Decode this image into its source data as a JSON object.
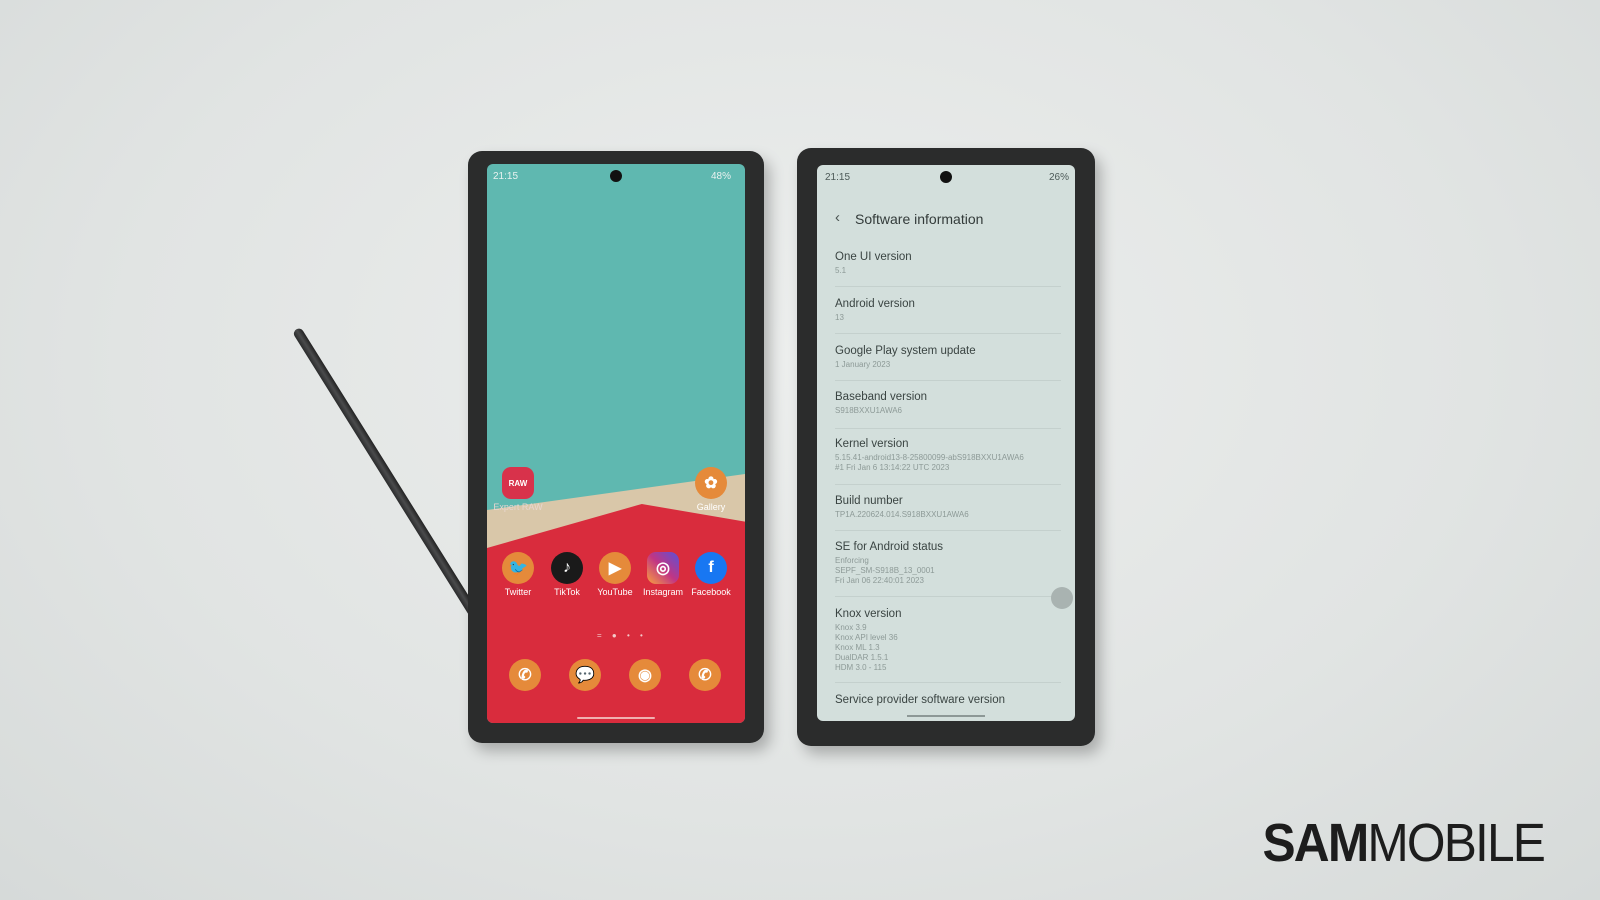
{
  "left_phone": {
    "status": {
      "time": "21:15",
      "battery": "48%"
    },
    "top_apps": [
      {
        "label": "Expert RAW",
        "badge": "RAW",
        "color": "#d8324b"
      },
      {
        "label": "Gallery",
        "color": "#e58a3a"
      }
    ],
    "apps": [
      {
        "label": "Twitter",
        "icon": "twitter-icon",
        "color": "#e58a3a"
      },
      {
        "label": "TikTok",
        "icon": "tiktok-icon",
        "color": "#1a1a1a"
      },
      {
        "label": "YouTube",
        "icon": "youtube-icon",
        "color": "#e58a3a"
      },
      {
        "label": "Instagram",
        "icon": "instagram-icon",
        "color": "#c13584"
      },
      {
        "label": "Facebook",
        "icon": "facebook-icon",
        "color": "#1877f2"
      }
    ],
    "dock": [
      {
        "icon": "phone-icon"
      },
      {
        "icon": "messages-icon"
      },
      {
        "icon": "camera-icon"
      },
      {
        "icon": "whatsapp-icon"
      }
    ]
  },
  "right_phone": {
    "status": {
      "time": "21:15",
      "battery": "26%"
    },
    "title": "Software information",
    "items": [
      {
        "title": "One UI version",
        "value": "5.1"
      },
      {
        "title": "Android version",
        "value": "13"
      },
      {
        "title": "Google Play system update",
        "value": "1 January 2023"
      },
      {
        "title": "Baseband version",
        "value": "S918BXXU1AWA6"
      },
      {
        "title": "Kernel version",
        "value": "5.15.41-android13-8-25800099-abS918BXXU1AWA6\n#1 Fri Jan 6 13:14:22 UTC 2023"
      },
      {
        "title": "Build number",
        "value": "TP1A.220624.014.S918BXXU1AWA6"
      },
      {
        "title": "SE for Android status",
        "value": "Enforcing\nSEPF_SM-S918B_13_0001\nFri Jan 06 22:40:01 2023"
      },
      {
        "title": "Knox version",
        "value": "Knox 3.9\nKnox API level 36\nKnox ML 1.3\nDualDAR 1.5.1\nHDM 3.0 - 115"
      },
      {
        "title": "Service provider software version",
        "value": ""
      }
    ]
  },
  "watermark": "SAMMOBILE"
}
